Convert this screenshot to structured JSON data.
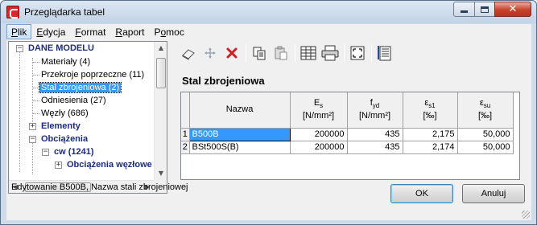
{
  "window": {
    "title": "Przeglądarka tabel"
  },
  "menu": {
    "items": [
      {
        "label": "Plik",
        "accel": "P"
      },
      {
        "label": "Edycja",
        "accel": "E"
      },
      {
        "label": "Format",
        "accel": "F"
      },
      {
        "label": "Raport",
        "accel": "R"
      },
      {
        "label": "Pomoc",
        "accel": "o"
      }
    ]
  },
  "tree": {
    "root": "DANE MODELU",
    "children": [
      "Materiały (4)",
      "Przekroje poprzeczne (11)",
      "Stal zbrojeniowa (2)",
      "Odniesienia (27)",
      "Węzły (686)"
    ],
    "elements": "Elementy",
    "loads": "Obciążenia",
    "cw": "cw (1241)",
    "partial": "Obciążenia węzłowe"
  },
  "panel": {
    "title": "Stal zbrojeniowa"
  },
  "table": {
    "columns": [
      {
        "main": "Nazwa",
        "sub": "",
        "unit": ""
      },
      {
        "main": "E",
        "sub": "s",
        "unit": "[N/mm²]"
      },
      {
        "main": "f",
        "sub": "yd",
        "unit": "[N/mm²]"
      },
      {
        "main": "ε",
        "sub": "s1",
        "unit": "[‰]"
      },
      {
        "main": "ε",
        "sub": "su",
        "unit": "[‰]"
      }
    ],
    "rows": [
      {
        "index": "1",
        "name": "B500B",
        "es": "200000",
        "fyd": "435",
        "es1": "2,175",
        "esu": "50,000"
      },
      {
        "index": "2",
        "name": "BSt500S(B)",
        "es": "200000",
        "fyd": "435",
        "es1": "2,174",
        "esu": "50,000"
      }
    ]
  },
  "status": {
    "text": "Edytowanie B500B, Nazwa stali zbrojeniowej"
  },
  "buttons": {
    "ok": "OK",
    "cancel": "Anuluj"
  },
  "colors": {
    "selection": "#3399ff",
    "tree_bold": "#1d2c80",
    "close_button": "#c7432c"
  }
}
